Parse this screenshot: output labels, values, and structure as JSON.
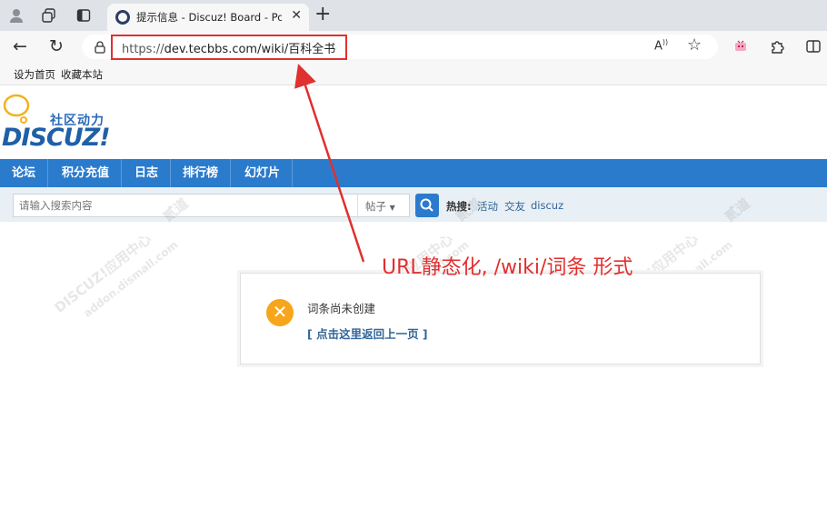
{
  "browser": {
    "tab_title": "提示信息 - Discuz! Board - Powe",
    "url_scheme": "https://",
    "url_rest": "dev.tecbbs.com/wiki/百科全书",
    "favorites": [
      "设为首页",
      "收藏本站"
    ]
  },
  "site": {
    "logo_cn": "社区动力",
    "logo_en": "DISCUZ!",
    "nav": [
      "论坛",
      "积分充值",
      "日志",
      "排行榜",
      "幻灯片"
    ],
    "search": {
      "placeholder": "请输入搜索内容",
      "type": "帖子",
      "hot_label": "热搜:",
      "hot_links": [
        "活动",
        "交友",
        "discuz"
      ]
    }
  },
  "message": {
    "text": "词条尚未创建",
    "link": "[ 点击这里返回上一页 ]"
  },
  "annotation": {
    "text": "URL静态化, /wiki/词条 形式",
    "color": "#e0302f"
  },
  "watermark": {
    "line1": "DISCUZ!应用中心",
    "line2": "addon.dismall.com",
    "line3": "贰道"
  }
}
